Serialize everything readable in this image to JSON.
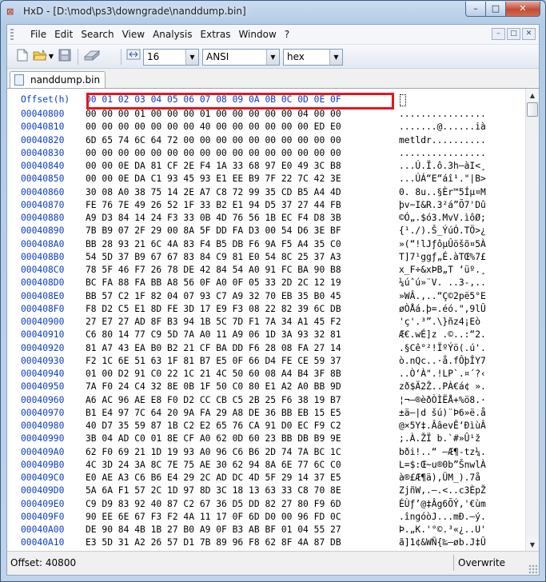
{
  "window": {
    "title": "HxD - [D:\\mod\\ps3\\downgrade\\nanddump.bin]",
    "minimize_glyph": "–",
    "maximize_glyph": "□",
    "close_glyph": "✕"
  },
  "menu": {
    "items": [
      "File",
      "Edit",
      "Search",
      "View",
      "Analysis",
      "Extras",
      "Window",
      "?"
    ],
    "mdi_buttons": [
      "–",
      "□",
      "✕"
    ]
  },
  "toolbar": {
    "bytes_per_row": "16",
    "charset": "ANSI",
    "offset_base": "hex",
    "icons": [
      "new-file-icon",
      "open-folder-icon",
      "save-icon",
      "disk-icon",
      "width-arrows-icon"
    ]
  },
  "tab": {
    "label": "nanddump.bin"
  },
  "hex": {
    "header_offset": "Offset(h)",
    "header_columns": "00 01 02 03 04 05 06 07 08 09 0A 0B 0C 0D 0E 0F",
    "rows": [
      {
        "offset": "00040800",
        "hex": "00 00 00 01 00 00 00 01 00 00 00 00 00 04 00 00",
        "text": "................"
      },
      {
        "offset": "00040810",
        "hex": "00 00 00 00 00 00 00 40 00 00 00 00 00 00 ED E0",
        "text": ".......@......ià"
      },
      {
        "offset": "00040820",
        "hex": "6D 65 74 6C 64 72 00 00 00 00 00 00 00 00 00 00",
        "text": "metldr.........."
      },
      {
        "offset": "00040830",
        "hex": "00 00 00 00 00 00 00 00 00 00 00 00 00 00 00 00",
        "text": "................"
      },
      {
        "offset": "00040840",
        "hex": "00 00 0E DA 81 CF 2E F4 1A 33 68 97 E0 49 3C B8",
        "text": "...Ú.Ï.ô.3h—àI<¸"
      },
      {
        "offset": "00040850",
        "hex": "00 00 0E DA C1 93 45 93 E1 EE B9 7F 22 7C 42 3E",
        "text": "...ÚÁ“E“áî¹.\"|B>"
      },
      {
        "offset": "00040860",
        "hex": "30 08 A0 38 75 14 2E A7 C8 72 99 35 CD B5 A4 4D",
        "text": "0. 8u..§Èr™5Íµ¤M"
      },
      {
        "offset": "00040870",
        "hex": "FE 76 7E 49 26 52 1F 33 B2 E1 94 D5 37 27 44 FB",
        "text": "þv~I&R.3²á”Õ7'Dû"
      },
      {
        "offset": "00040880",
        "hex": "A9 D3 84 14 24 F3 33 0B 4D 76 56 1B EC F4 D8 3B",
        "text": "©Ó„.$ó3.MvV.ìôØ;"
      },
      {
        "offset": "00040890",
        "hex": "7B B9 07 2F 29 00 8A 5F DD FA D3 00 54 D6 3E BF",
        "text": "{¹./).Š_ÝúÓ.TÖ>¿"
      },
      {
        "offset": "000408A0",
        "hex": "BB 28 93 21 6C 4A 83 F4 B5 DB F6 9A F5 A4 35 C0",
        "text": "»(“!lJƒôµÛöšõ¤5À"
      },
      {
        "offset": "000408B0",
        "hex": "54 5D 37 B9 67 67 83 84 C9 81 E0 54 8C 25 37 A3",
        "text": "T]7¹ggƒ„É.àTŒ%7£"
      },
      {
        "offset": "000408C0",
        "hex": "78 5F 46 F7 26 78 DE 42 84 54 A0 91 FC BA 90 B8",
        "text": "x_F÷&xÞB„T ‘üº.¸"
      },
      {
        "offset": "000408D0",
        "hex": "BC FA 88 FA BB A8 56 0F A0 0F 05 33 2D 2C 12 19",
        "text": "¼úˆú»¨V. ..3-,.."
      },
      {
        "offset": "000408E0",
        "hex": "BB 57 C2 1F 82 04 07 93 C7 A9 32 70 EB 35 B0 45",
        "text": "»WÂ.‚..“Ç©2pë5°E"
      },
      {
        "offset": "000408F0",
        "hex": "F8 D2 C5 E1 8D FE 3D 17 E9 F3 08 22 82 39 6C DB",
        "text": "øÒÅá.þ=.éó.\"‚9lÛ"
      },
      {
        "offset": "00040900",
        "hex": "27 E7 27 AD 8F B3 94 1B 5C 7D F1 7A 34 A1 45 F2",
        "text": "'ç'­.³”.\\}ñz4¡Eò"
      },
      {
        "offset": "00040910",
        "hex": "C6 80 14 77 C9 5D 7A A0 11 A9 06 1D 3A 93 32 81",
        "text": "Æ€.wÉ]z .©..:“2."
      },
      {
        "offset": "00040920",
        "hex": "81 A7 43 EA B0 B2 21 CF BA DD F6 28 08 FA 27 14",
        "text": ".§Cê°²!ÏºÝö(.ú'."
      },
      {
        "offset": "00040930",
        "hex": "F2 1C 6E 51 63 1F 81 B7 E5 0F 66 D4 FE CE 59 37",
        "text": "ò.nQc..·å.fÔþÎY7"
      },
      {
        "offset": "00040940",
        "hex": "01 00 D2 91 C0 22 1C 21 4C 50 60 08 A4 B4 3F 8B",
        "text": "..Ò‘À\".!LP`.¤´?‹"
      },
      {
        "offset": "00040950",
        "hex": "7A F0 24 C4 32 8E 0B 1F 50 C0 80 E1 A2 A0 BB 9D",
        "text": "zð$Ä2Ž..PÀ€á¢ »."
      },
      {
        "offset": "00040960",
        "hex": "A6 AC 96 AE E8 F0 D2 CC CB C5 2B 25 F6 38 19 B7",
        "text": "¦¬–®èðÒÌËÅ+%ö8.·"
      },
      {
        "offset": "00040970",
        "hex": "B1 E4 97 7C 64 20 9A FA 29 A8 DE 36 BB EB 15 E5",
        "text": "±ä—|d šú)¨Þ6»ë.å"
      },
      {
        "offset": "00040980",
        "hex": "40 D7 35 59 87 1B C2 E2 65 76 CA 91 D0 EC F9 C2",
        "text": "@×5Y‡.ÂâevÊ‘ÐìùÂ"
      },
      {
        "offset": "00040990",
        "hex": "3B 04 AD C0 01 8E CF A0 62 0D 60 23 BB DB B9 9E",
        "text": ";.­À.ŽÏ b.`#»Û¹ž"
      },
      {
        "offset": "000409A0",
        "hex": "62 F0 69 21 1D 19 93 A0 96 C6 B6 2D 74 7A BC 1C",
        "text": "bði!..“ –Æ¶-tz¼."
      },
      {
        "offset": "000409B0",
        "hex": "4C 3D 24 3A 8C 7E 75 AE 30 62 94 8A 6E 77 6C C0",
        "text": "L=$:Œ~u®0b”ŠnwlÀ"
      },
      {
        "offset": "000409C0",
        "hex": "E0 AE A3 C6 B6 E4 29 2C AD DC 4D 5F 29 14 37 E5",
        "text": "à®£Æ¶ä),­ÜM_).7å"
      },
      {
        "offset": "000409D0",
        "hex": "5A 6A F1 57 2C 1D 97 8D 3C 18 13 63 33 C8 70 8E",
        "text": "ZjñW,.—.<..c3ÈpŽ"
      },
      {
        "offset": "000409E0",
        "hex": "C9 D9 83 92 40 87 C2 67 36 D5 DD 82 27 80 F9 6D",
        "text": "ÉÙƒ’@‡Âg6ÕÝ‚'€ùm"
      },
      {
        "offset": "000409F0",
        "hex": "90 EE 6E 67 F3 F2 4A 11 17 0F 6D D0 00 96 FD 0C",
        "text": ".îngóòJ...mÐ.–ý."
      },
      {
        "offset": "00040A00",
        "hex": "DE 90 84 4B 1B 27 B0 A9 0F B3 AB BF 01 04 55 27",
        "text": "Þ.„K.'°©.³«¿..U'"
      },
      {
        "offset": "00040A10",
        "hex": "E3 5D 31 A2 26 57 D1 7B 89 96 F8 62 8F 4A 87 DB",
        "text": "ã]1¢&WÑ{‰–øb.J‡Û"
      },
      {
        "offset": "00040A20",
        "hex": "38 D9 68 43 F5 05 50 83 C8 D7 61 11 6B 8D 1A 8C",
        "text": "8ÙhCõ.PƒÈ×a.k..Œ"
      }
    ]
  },
  "status": {
    "offset": "Offset: 40800",
    "mode": "Overwrite"
  }
}
